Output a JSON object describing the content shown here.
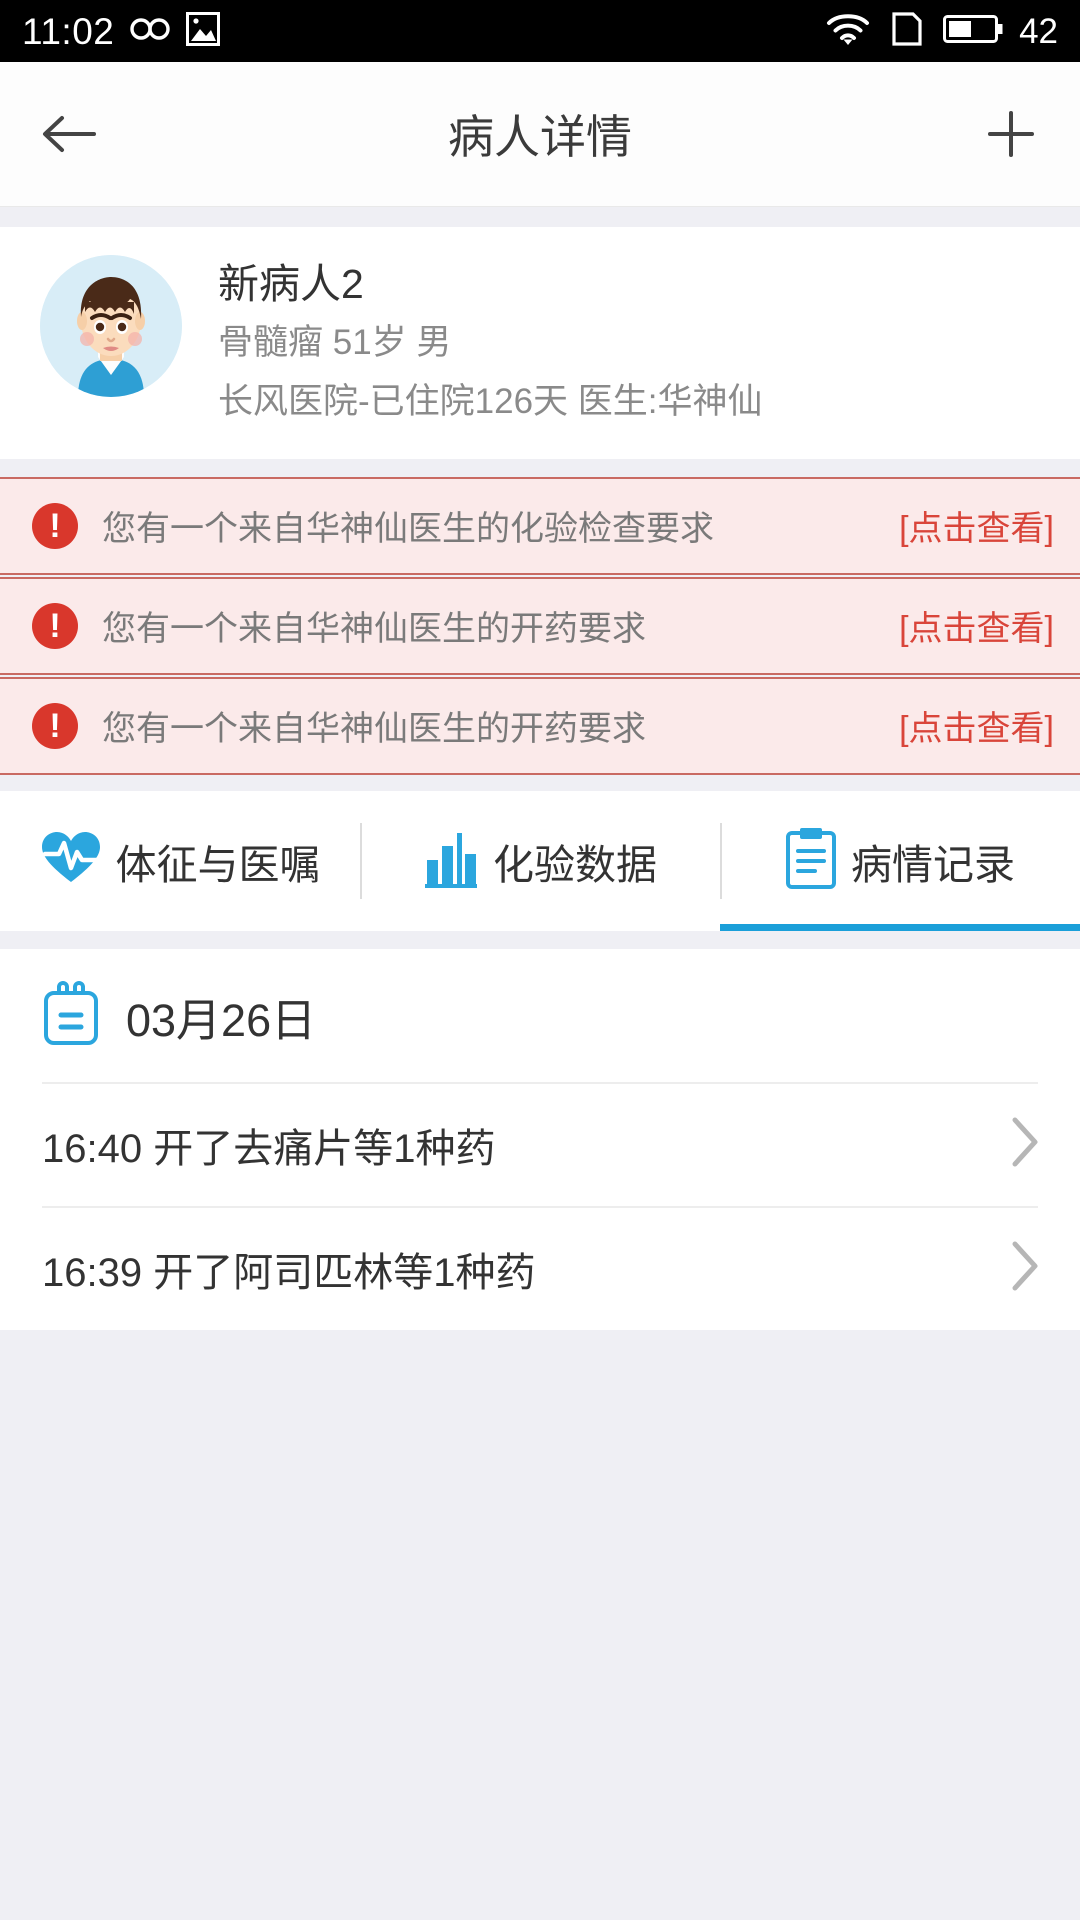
{
  "status_bar": {
    "time": "11:02",
    "battery_level": "42",
    "icons": [
      "infinity-icon",
      "image-icon",
      "wifi-icon",
      "sim-icon",
      "battery-icon"
    ]
  },
  "header": {
    "title": "病人详情",
    "back_icon": "back-arrow-icon",
    "add_icon": "plus-icon"
  },
  "patient": {
    "name": "新病人2",
    "meta": "骨髓瘤 51岁 男",
    "hospital": "长风医院-已住院126天  医生:华神仙"
  },
  "alerts": [
    {
      "text": "您有一个来自华神仙医生的化验检查要求",
      "link": "[点击查看]"
    },
    {
      "text": "您有一个来自华神仙医生的开药要求",
      "link": "[点击查看]"
    },
    {
      "text": "您有一个来自华神仙医生的开药要求",
      "link": "[点击查看]"
    }
  ],
  "tabs": [
    {
      "label": "体征与医嘱",
      "icon": "heartbeat-icon",
      "active": false
    },
    {
      "label": "化验数据",
      "icon": "bar-chart-icon",
      "active": false
    },
    {
      "label": "病情记录",
      "icon": "clipboard-icon",
      "active": true
    }
  ],
  "records": {
    "date": "03月26日",
    "date_icon": "calendar-icon",
    "items": [
      {
        "time": "16:40",
        "text": "16:40 开了去痛片等1种药"
      },
      {
        "time": "16:39",
        "text": "16:39 开了阿司匹林等1种药"
      }
    ]
  },
  "colors": {
    "accent": "#1a9fd9",
    "alert_bg": "#fbeaea",
    "alert_border": "#c96a62",
    "alert_link": "#d9453a",
    "alert_icon": "#d9372c",
    "page_bg": "#efeff4"
  }
}
